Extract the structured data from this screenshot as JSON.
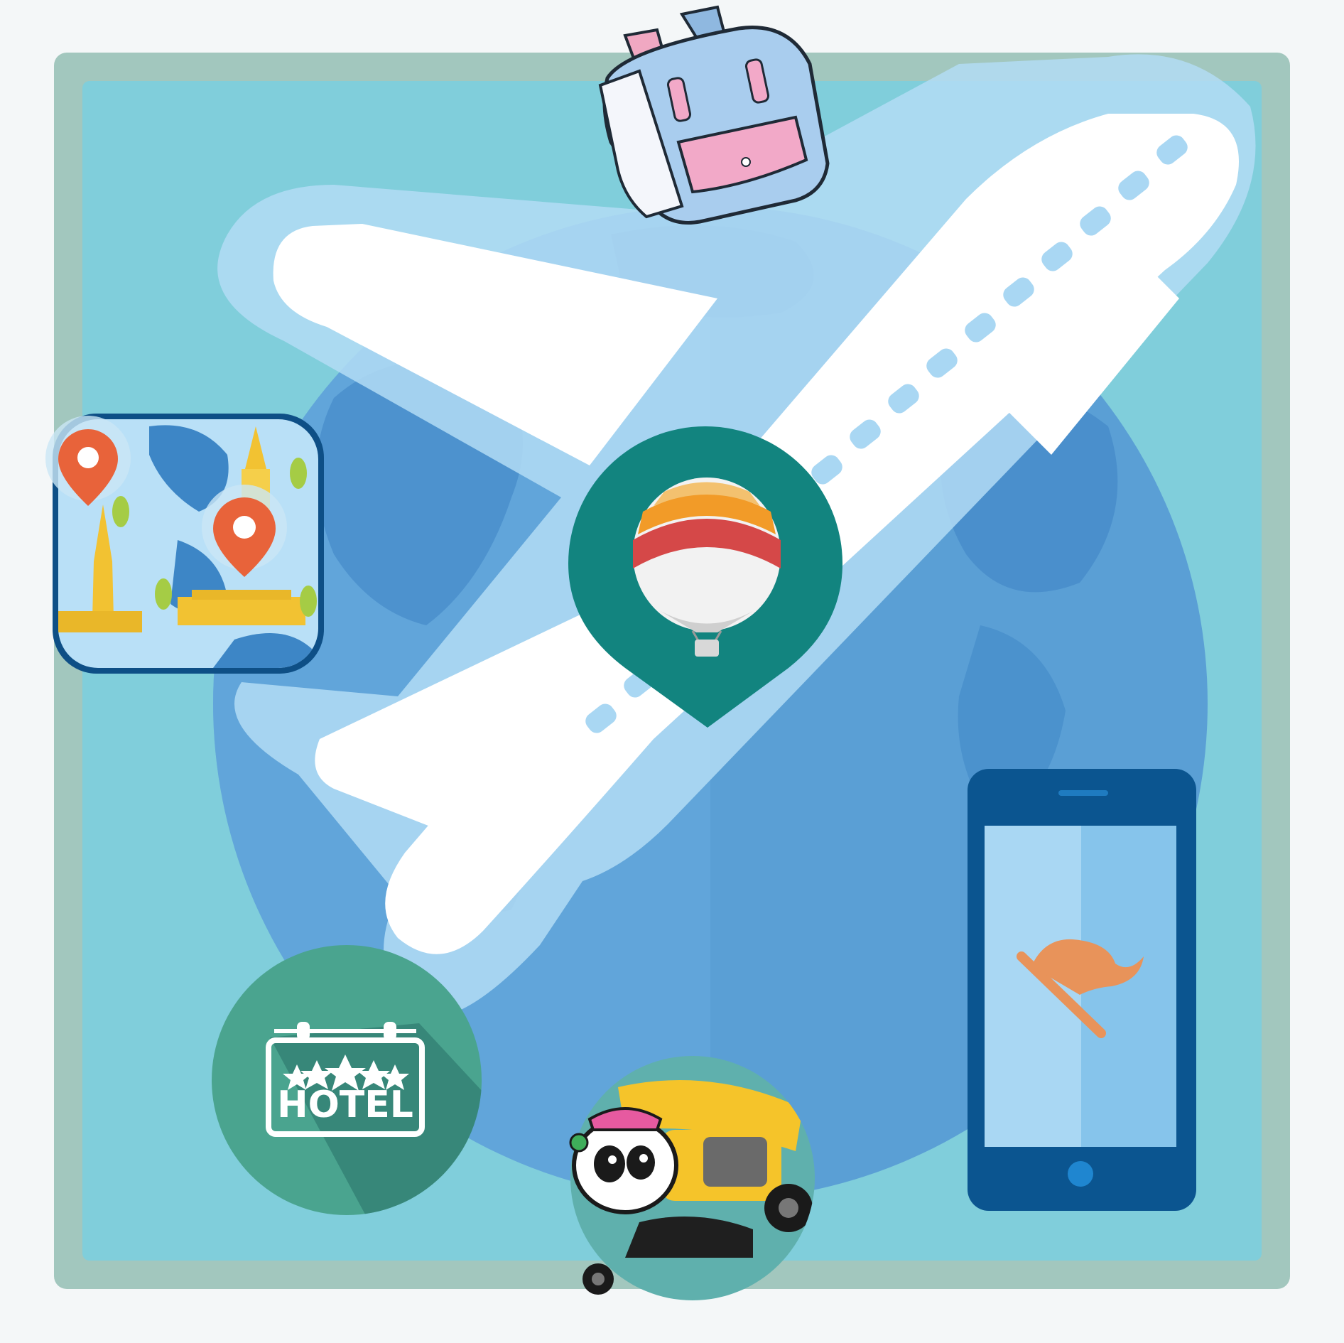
{
  "colors": {
    "page_bg": "#f4f7f8",
    "frame": "#a2c7be",
    "panel": "#80cedb",
    "globe": "#5a9fd5",
    "plane": "#ffffff",
    "pin": "#12847f",
    "hotel_bg": "#4aa48f",
    "phone": "#0b5590",
    "phone_screen": "#a9d7f3"
  },
  "icons": [
    "backpack-icon",
    "airplane-icon",
    "globe-icon",
    "map-pin-balloon-icon",
    "thai-temple-map-icon",
    "hotel-sign-icon",
    "tuk-tuk-icon",
    "smartphone-flag-icon"
  ],
  "hotel": {
    "label": "HOTEL",
    "stars": 5
  }
}
